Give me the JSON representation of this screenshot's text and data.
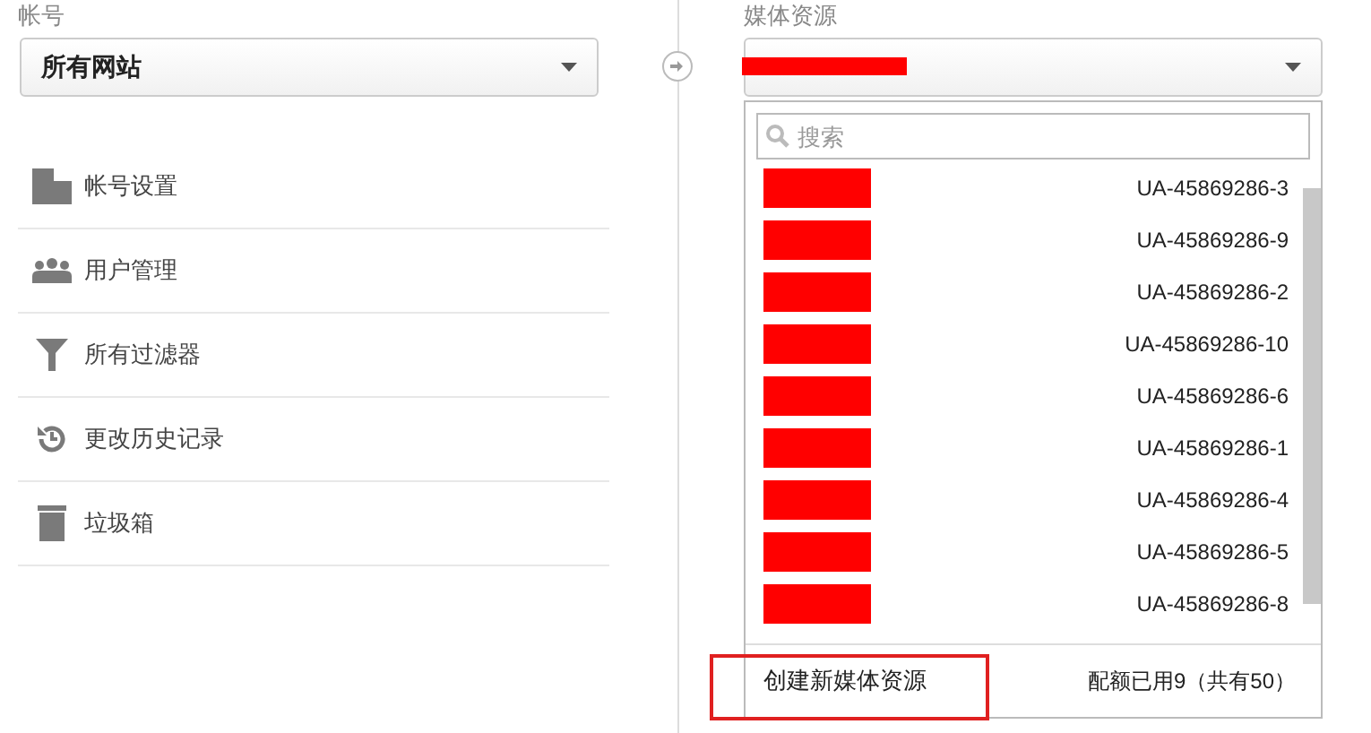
{
  "account": {
    "label": "帐号",
    "value": "所有网站"
  },
  "menu": [
    {
      "kind": "building",
      "label": "帐号设置"
    },
    {
      "kind": "users",
      "label": "用户管理"
    },
    {
      "kind": "filter",
      "label": "所有过滤器"
    },
    {
      "kind": "history",
      "label": "更改历史记录"
    },
    {
      "kind": "trash",
      "label": "垃圾箱"
    }
  ],
  "property": {
    "label": "媒体资源",
    "search_placeholder": "搜索",
    "items": [
      {
        "id": "UA-45869286-3"
      },
      {
        "id": "UA-45869286-9"
      },
      {
        "id": "UA-45869286-2"
      },
      {
        "id": "UA-45869286-10"
      },
      {
        "id": "UA-45869286-6"
      },
      {
        "id": "UA-45869286-1"
      },
      {
        "id": "UA-45869286-4"
      },
      {
        "id": "UA-45869286-5"
      },
      {
        "id": "UA-45869286-8"
      }
    ],
    "create_label": "创建新媒体资源",
    "quota": "配额已用9（共有50）"
  }
}
